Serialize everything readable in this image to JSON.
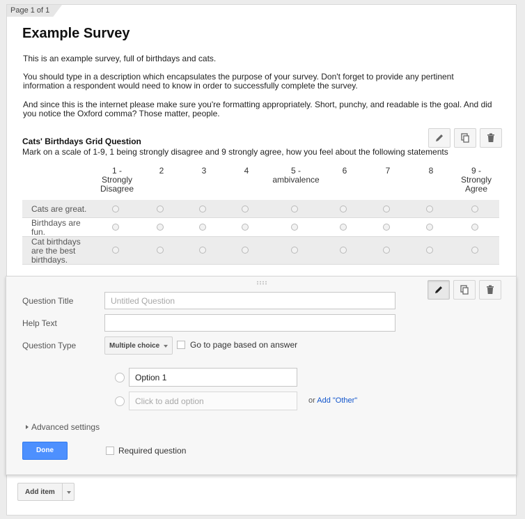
{
  "page_tab": "Page 1 of 1",
  "survey": {
    "title": "Example Survey",
    "description": [
      "This is an example survey, full of birthdays and cats.",
      "You should type in a description which encapsulates the purpose of your survey. Don't forget to provide any pertinent information a respondent would need to know in order to successfully complete the survey.",
      "And since this is the internet please make sure you're formatting appropriately. Short, punchy, and readable is the goal. And did you notice the Oxford comma? Those matter, people."
    ]
  },
  "grid_question": {
    "title": "Cats' Birthdays Grid Question",
    "help": "Mark on a scale of 1-9, 1 being strongly disagree and 9 strongly agree, how you feel about the following statements",
    "columns": [
      "1 - Strongly Disagree",
      "2",
      "3",
      "4",
      "5 - ambivalence",
      "6",
      "7",
      "8",
      "9 - Strongly Agree"
    ],
    "rows": [
      "Cats are great.",
      "Birthdays are fun.",
      "Cat birthdays are the best birthdays."
    ]
  },
  "toolbar_icons": [
    "pencil-icon",
    "duplicate-icon",
    "trash-icon"
  ],
  "editor": {
    "question_title_label": "Question Title",
    "question_title_placeholder": "Untitled Question",
    "help_text_label": "Help Text",
    "help_text_value": "",
    "question_type_label": "Question Type",
    "question_type_value": "Multiple choice",
    "go_to_page_label": "Go to page based on answer",
    "option1_value": "Option 1",
    "add_option_placeholder": "Click to add option",
    "or_text": "or",
    "add_other_link": "Add \"Other\"",
    "advanced_settings": "Advanced settings",
    "done_label": "Done",
    "required_label": "Required question"
  },
  "add_item_label": "Add item",
  "colors": {
    "accent": "#4d90fe",
    "link": "#1155cc",
    "row_shade": "#ececec"
  }
}
